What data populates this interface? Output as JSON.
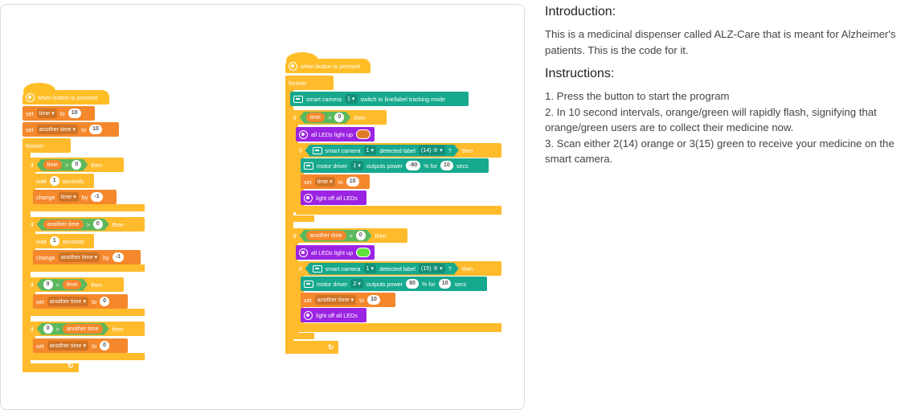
{
  "info": {
    "intro_heading": "Introduction:",
    "intro_text": "This is a medicinal dispenser called ALZ-Care that is meant for Alzheimer's patients. This is the code for it.",
    "instructions_heading": "Instructions:",
    "steps": [
      "1. Press the button to start the program",
      "2. In 10 second intervals, orange/green will rapidly flash, signifying that orange/green users are to collect their medicine now.",
      "3. Scan either 2(14) orange or 3(15) green to receive your medicine on the smart camera."
    ]
  },
  "left_script": {
    "hat": "when button is pressed",
    "set": "set",
    "to": "to",
    "var_time": "time ▾",
    "var_another": "another time ▾",
    "val_10": "10",
    "forever": "forever",
    "if": "if",
    "then": "then",
    "time": "time",
    "another_time": "another time",
    "gt": ">",
    "zero": "0",
    "wait": "wait",
    "one": "1",
    "seconds": "seconds",
    "change": "change",
    "by": "by",
    "minus_one": "-1",
    "rot": "↻"
  },
  "right_script": {
    "hat": "when button is pressed",
    "forever": "forever",
    "camera": "smart camera",
    "one_dd": "1 ▾",
    "two_dd": "2 ▾",
    "switch_mode": "switch to line/label tracking mode",
    "if": "if",
    "then": "then",
    "time": "time",
    "another_time": "another time",
    "eq": "=",
    "zero": "0",
    "all_leds": "all LEDs light up",
    "detected_label": "detected label",
    "label14": "(14) ② ▾",
    "label15": "(15) ③ ▾",
    "q": "?",
    "motor_driver": "motor driver",
    "outputs_power": "outputs power",
    "pow1": "-80",
    "pow2": "80",
    "pct_for": "% for",
    "ten": "10",
    "secs": "secs",
    "set": "set",
    "to": "to",
    "var_time": "time ▾",
    "var_another": "another time ▾",
    "light_off": "light off all LEDs",
    "rot": "↻"
  },
  "colors": {
    "event": "#ffbe26",
    "control": "#ffbb2b",
    "variable": "#f5882c",
    "operator": "#5cb85c",
    "camera": "#17a98e",
    "led": "#9b24e2",
    "swatch_orange": "#e07a2a",
    "swatch_green": "#5ee13a"
  }
}
